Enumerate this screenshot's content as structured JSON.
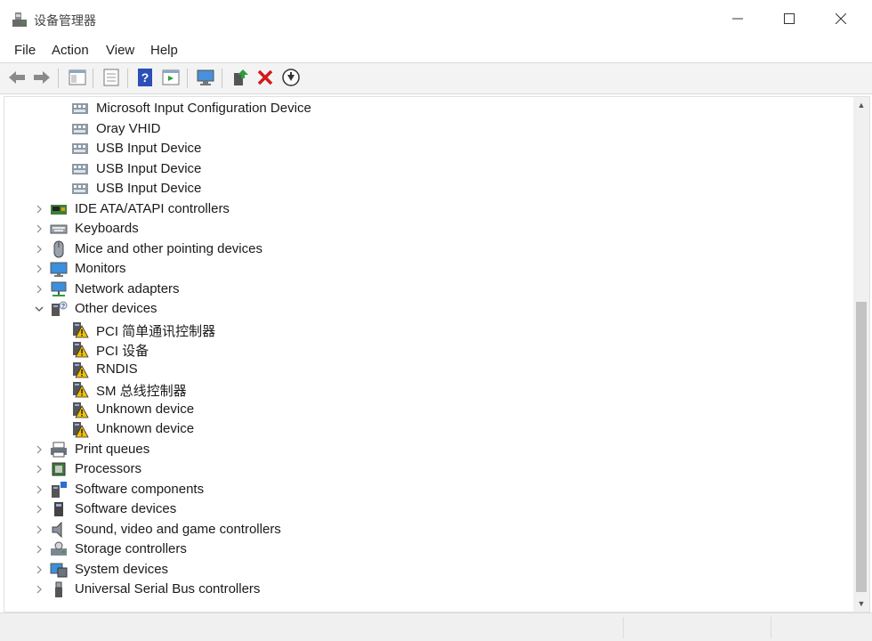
{
  "window": {
    "title": "设备管理器"
  },
  "menu": {
    "items": [
      "File",
      "Action",
      "View",
      "Help"
    ]
  },
  "toolbar": {
    "buttons": [
      "back-arrow-icon",
      "forward-arrow-icon",
      "show-hide-tree-icon",
      "properties-icon",
      "help-icon",
      "action-pane-icon",
      "scan-hardware-icon",
      "update-driver-icon",
      "uninstall-icon",
      "disable-device-icon"
    ]
  },
  "tree": {
    "rows": [
      {
        "label": "Microsoft Input Configuration Device",
        "level": 2,
        "icon": "hid-icon"
      },
      {
        "label": "Oray VHID",
        "level": 2,
        "icon": "hid-icon"
      },
      {
        "label": "USB Input Device",
        "level": 2,
        "icon": "hid-icon"
      },
      {
        "label": "USB Input Device",
        "level": 2,
        "icon": "hid-icon"
      },
      {
        "label": "USB Input Device",
        "level": 2,
        "icon": "hid-icon"
      },
      {
        "label": "IDE ATA/ATAPI controllers",
        "level": 1,
        "icon": "ide-controller-icon",
        "expander": "collapsed"
      },
      {
        "label": "Keyboards",
        "level": 1,
        "icon": "keyboard-icon",
        "expander": "collapsed"
      },
      {
        "label": "Mice and other pointing devices",
        "level": 1,
        "icon": "mouse-icon",
        "expander": "collapsed"
      },
      {
        "label": "Monitors",
        "level": 1,
        "icon": "monitor-icon",
        "expander": "collapsed"
      },
      {
        "label": "Network adapters",
        "level": 1,
        "icon": "network-adapter-icon",
        "expander": "collapsed"
      },
      {
        "label": "Other devices",
        "level": 1,
        "icon": "other-devices-icon",
        "expander": "expanded"
      },
      {
        "label": "PCI 简单通讯控制器",
        "level": 2,
        "icon": "warning-device-icon"
      },
      {
        "label": "PCI 设备",
        "level": 2,
        "icon": "warning-device-icon"
      },
      {
        "label": "RNDIS",
        "level": 2,
        "icon": "warning-device-icon"
      },
      {
        "label": "SM 总线控制器",
        "level": 2,
        "icon": "warning-device-icon"
      },
      {
        "label": "Unknown device",
        "level": 2,
        "icon": "warning-device-icon"
      },
      {
        "label": "Unknown device",
        "level": 2,
        "icon": "warning-device-icon"
      },
      {
        "label": "Print queues",
        "level": 1,
        "icon": "printer-icon",
        "expander": "collapsed"
      },
      {
        "label": "Processors",
        "level": 1,
        "icon": "processor-icon",
        "expander": "collapsed"
      },
      {
        "label": "Software components",
        "level": 1,
        "icon": "software-component-icon",
        "expander": "collapsed"
      },
      {
        "label": "Software devices",
        "level": 1,
        "icon": "software-device-icon",
        "expander": "collapsed"
      },
      {
        "label": "Sound, video and game controllers",
        "level": 1,
        "icon": "speaker-icon",
        "expander": "collapsed"
      },
      {
        "label": "Storage controllers",
        "level": 1,
        "icon": "storage-controller-icon",
        "expander": "collapsed"
      },
      {
        "label": "System devices",
        "level": 1,
        "icon": "system-devices-icon",
        "expander": "collapsed"
      },
      {
        "label": "Universal Serial Bus controllers",
        "level": 1,
        "icon": "usb-icon",
        "expander": "collapsed"
      }
    ]
  },
  "colors": {
    "accent": "#1e6fc8",
    "danger": "#d11a1a",
    "warning": "#f2c200"
  }
}
